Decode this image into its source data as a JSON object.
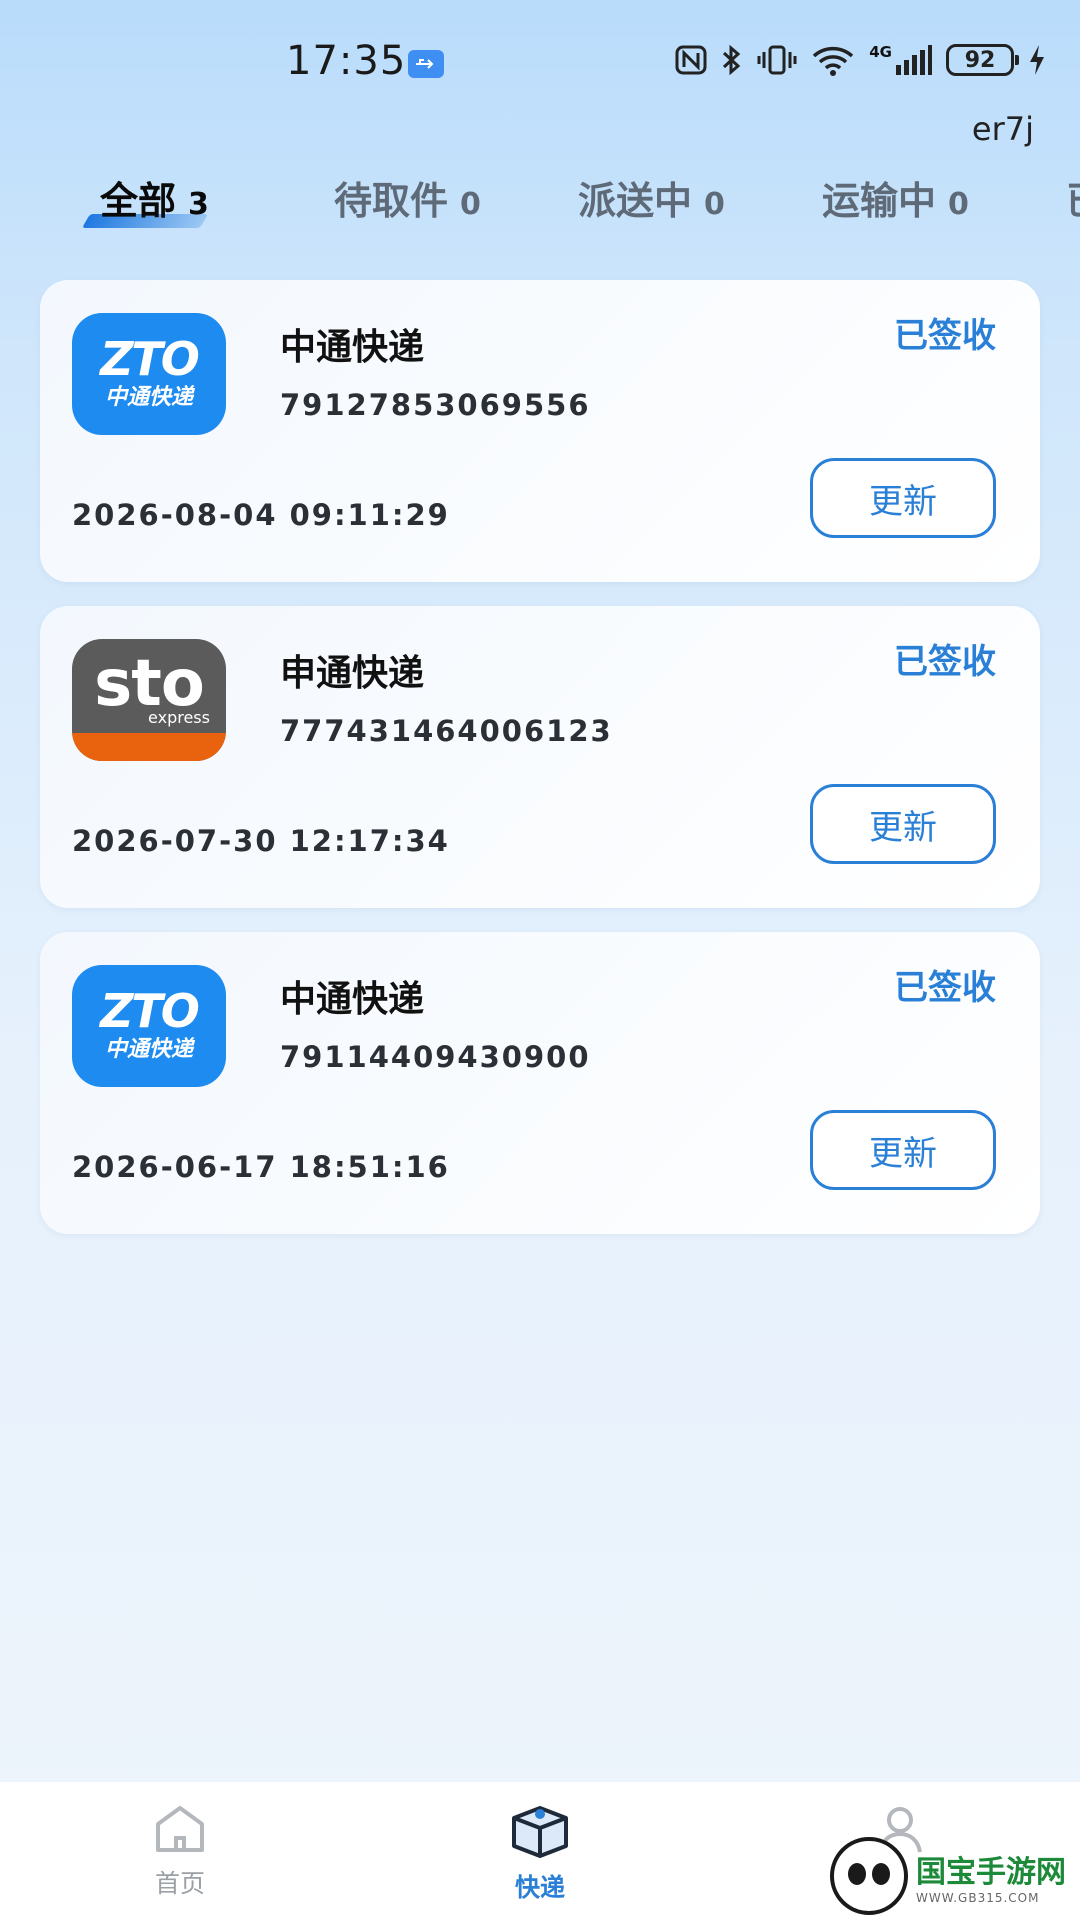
{
  "status_bar": {
    "time": "17:35",
    "network": "4G",
    "battery": "92",
    "icons": [
      "usb-icon",
      "nfc-icon",
      "bluetooth-icon",
      "vibrate-icon",
      "wifi-icon",
      "signal-icon",
      "battery-icon",
      "charging-icon"
    ]
  },
  "header": {
    "user": "er7j"
  },
  "tabs": [
    {
      "label": "全部",
      "count": "3",
      "active": true
    },
    {
      "label": "待取件",
      "count": "0",
      "active": false
    },
    {
      "label": "派送中",
      "count": "0",
      "active": false
    },
    {
      "label": "运输中",
      "count": "0",
      "active": false
    },
    {
      "label": "已",
      "count": "",
      "active": false
    }
  ],
  "parcels": [
    {
      "logo": "zto-logo",
      "logo_text": {
        "top": "ZTO",
        "bottom": "中通快递"
      },
      "courier": "中通快递",
      "tracking": "79127853069556",
      "status": "已签收",
      "date": "2026-08-04 09:11:29",
      "button": "更新"
    },
    {
      "logo": "sto-logo",
      "logo_text": {
        "top": "sto",
        "bottom": "express"
      },
      "courier": "申通快递",
      "tracking": "777431464006123",
      "status": "已签收",
      "date": "2026-07-30 12:17:34",
      "button": "更新"
    },
    {
      "logo": "zto-logo",
      "logo_text": {
        "top": "ZTO",
        "bottom": "中通快递"
      },
      "courier": "中通快递",
      "tracking": "79114409430900",
      "status": "已签收",
      "date": "2026-06-17 18:51:16",
      "button": "更新"
    }
  ],
  "bottom_nav": [
    {
      "label": "首页",
      "icon": "home-icon",
      "active": false
    },
    {
      "label": "快递",
      "icon": "package-icon",
      "active": true
    },
    {
      "label": "",
      "icon": "user-icon",
      "active": false
    }
  ],
  "watermark": {
    "title": "国宝手游网",
    "url": "WWW.GB315.COM"
  },
  "colors": {
    "accent": "#2a7fd6",
    "zto_blue": "#1d8bf0",
    "sto_gray": "#5b5b5b",
    "sto_orange": "#e9620e"
  }
}
